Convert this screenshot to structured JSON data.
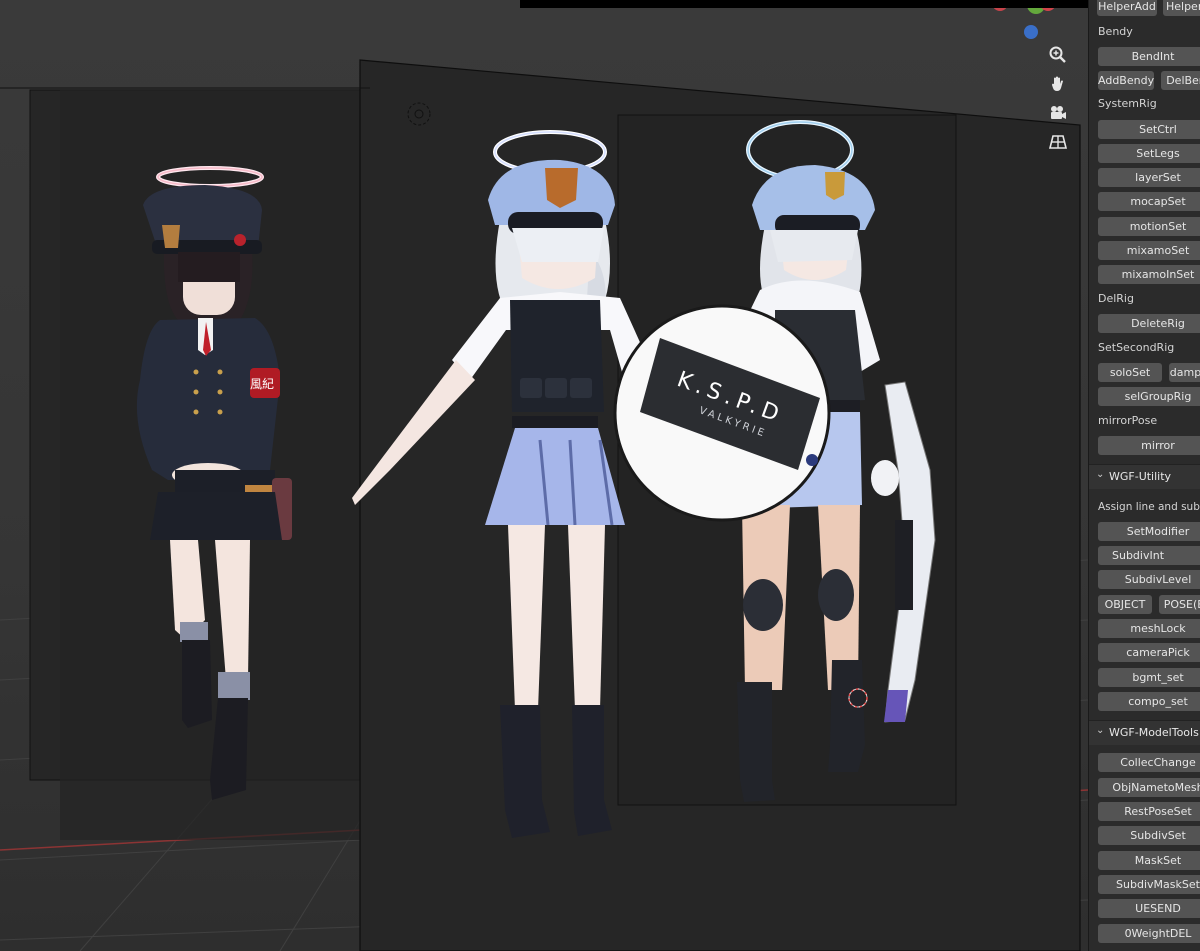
{
  "viewport": {
    "nav_icons": [
      "zoom-icon",
      "hand-pan-icon",
      "camera-icon",
      "grid-view-icon"
    ],
    "gizmo_colors": {
      "x": "#c8434a",
      "y": "#64a83c",
      "z": "#3a6fc8"
    },
    "scene": {
      "armband_text": "風紀",
      "shield_text": "K.S.P.D",
      "shield_subtext": "VALKYRIE"
    }
  },
  "panel": {
    "top_buttons": [
      "HelperAdd",
      "HelperR"
    ],
    "sections": {
      "bendy_label": "Bendy",
      "bendint": "BendInt",
      "addbendy": "AddBendy",
      "delbendy": "DelBen",
      "systemrig_label": "SystemRig",
      "setctrl": "SetCtrl",
      "setlegs": "SetLegs",
      "layerset": "layerSet",
      "mocapset": "mocapSet",
      "motionset": "motionSet",
      "mixamoset": "mixamoSet",
      "mixamoinset": "mixamoInSet",
      "delrig_label": "DelRig",
      "deleterig": "DeleteRig",
      "setsecondrig_label": "SetSecondRig",
      "soloset": "soloSet",
      "dampset": "dampS",
      "selgrouprig": "selGroupRig",
      "mirrorpose_label": "mirrorPose",
      "mirror": "mirror"
    },
    "utility": {
      "header": "WGF-Utility",
      "assign_label": "Assign line and subdiv",
      "setmodifier": "SetModifier",
      "subdivint": "SubdivInt",
      "subdivlevel": "SubdivLevel",
      "object": "OBJECT",
      "pose": "POSE(E",
      "meshlock": "meshLock",
      "camerapick": "cameraPick",
      "bgmt_set": "bgmt_set",
      "compo_set": "compo_set"
    },
    "modeltools": {
      "header": "WGF-ModelTools",
      "collecchange": "CollecChange",
      "objnametomesh": "ObjNametoMesh",
      "restposeset": "RestPoseSet",
      "subdivset": "SubdivSet",
      "maskset": "MaskSet",
      "subdivmaskset": "SubdivMaskSet",
      "uesend": "UESEND",
      "zeroweightdel": "0WeightDEL"
    }
  }
}
